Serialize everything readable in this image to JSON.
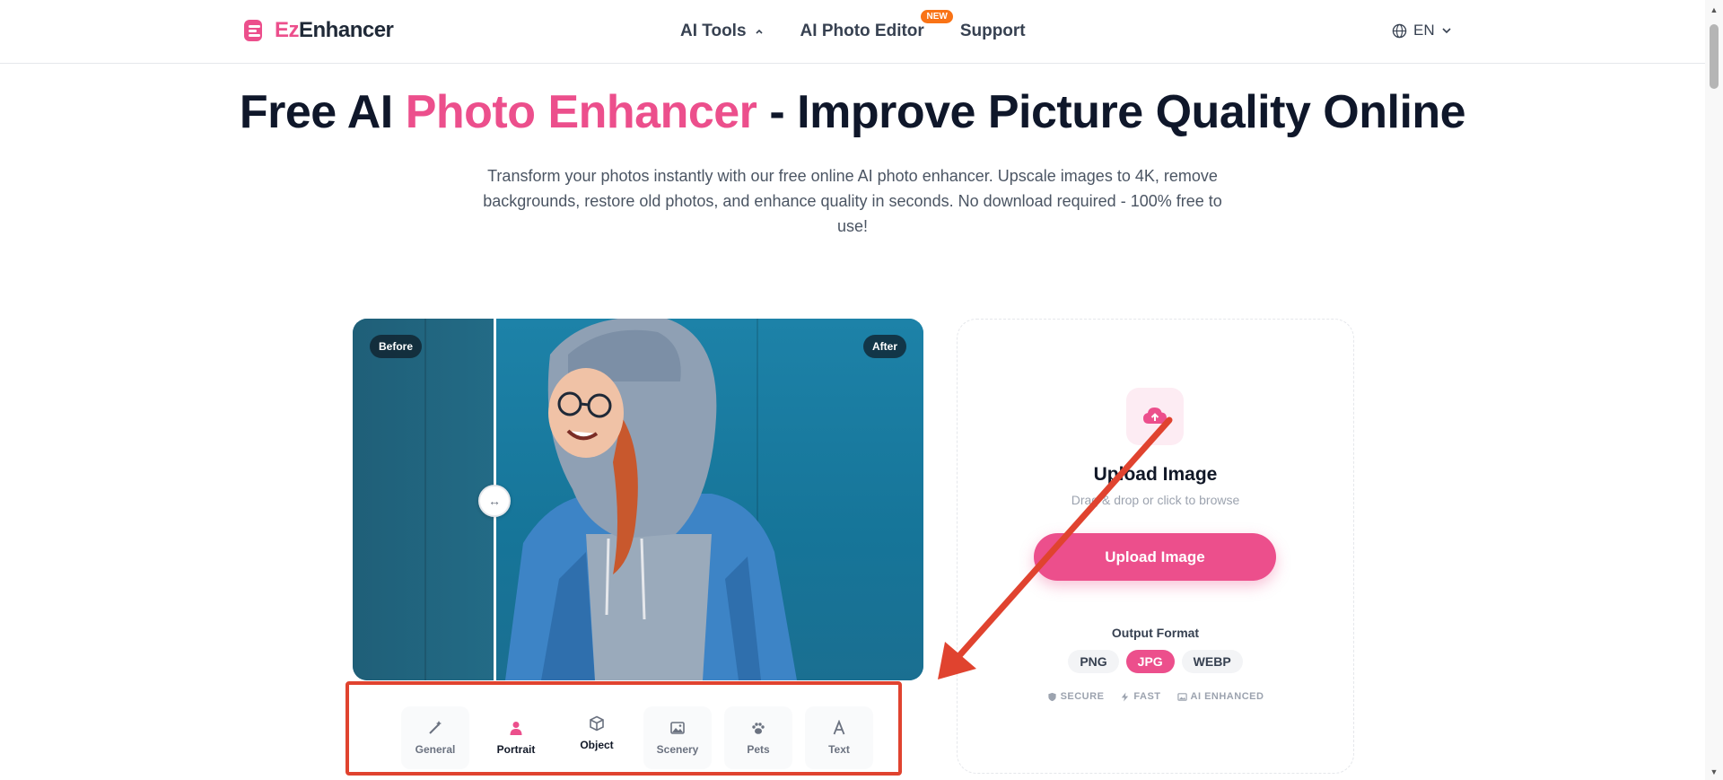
{
  "header": {
    "brand_prefix": "Ez",
    "brand_suffix": "Enhancer",
    "nav": [
      {
        "label": "AI Tools"
      },
      {
        "label": "AI Photo Editor",
        "badge": "NEW"
      },
      {
        "label": "Support"
      }
    ],
    "language": "EN"
  },
  "hero": {
    "title_part1": "Free AI ",
    "title_accent": "Photo Enhancer",
    "title_part2": " - Improve Picture Quality Online",
    "subtitle": "Transform your photos instantly with our free online AI photo enhancer. Upscale images to 4K, remove backgrounds, restore old photos, and enhance quality in seconds. No download required - 100% free to use!"
  },
  "compare": {
    "before_label": "Before",
    "after_label": "After"
  },
  "categories": [
    {
      "label": "General",
      "icon": "magic-wand-icon"
    },
    {
      "label": "Portrait",
      "icon": "person-icon",
      "active": true
    },
    {
      "label": "Object",
      "icon": "cube-icon"
    },
    {
      "label": "Scenery",
      "icon": "image-icon"
    },
    {
      "label": "Pets",
      "icon": "paw-icon"
    },
    {
      "label": "Text",
      "icon": "letter-a-icon"
    }
  ],
  "upload": {
    "title": "Upload Image",
    "hint": "Drag & drop or click to browse",
    "button": "Upload Image",
    "format_label": "Output Format",
    "formats": [
      "PNG",
      "JPG",
      "WEBP"
    ],
    "selected_format": "JPG",
    "features": [
      "SECURE",
      "FAST",
      "AI ENHANCED"
    ]
  },
  "colors": {
    "brand_pink": "#ec4f8c",
    "annotation_red": "#e0432f",
    "new_badge": "#f97316"
  }
}
